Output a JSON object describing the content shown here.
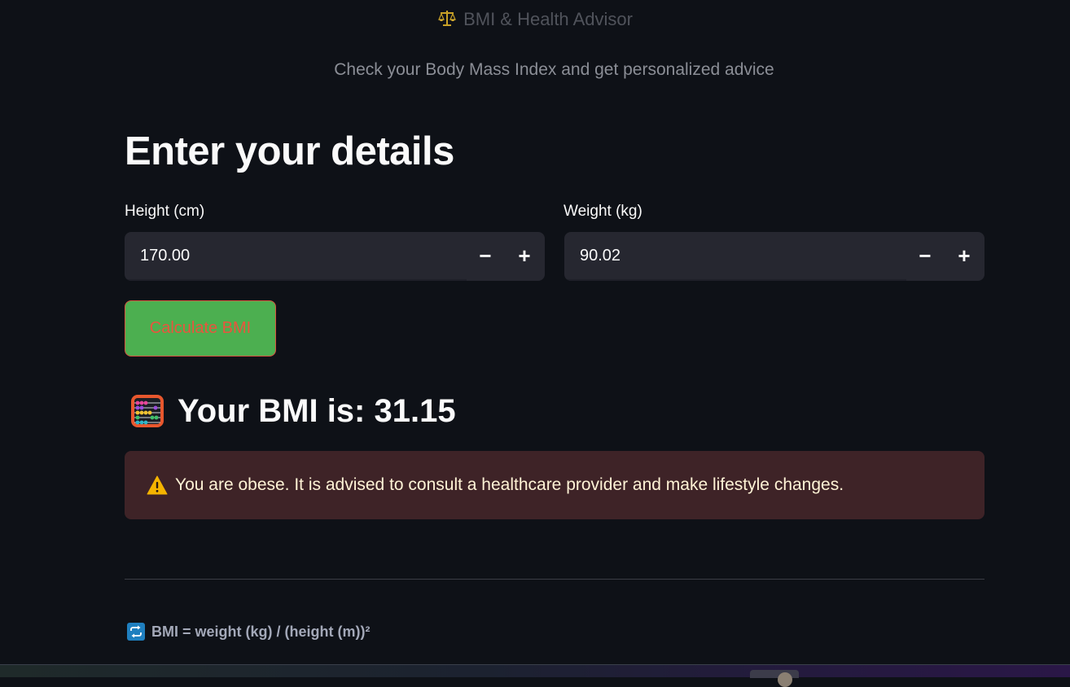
{
  "app": {
    "title": "BMI & Health Advisor",
    "title_icon": "balance-scale-icon",
    "subtitle": "Check your Body Mass Index and get personalized advice"
  },
  "form": {
    "heading": "Enter your details",
    "height": {
      "label": "Height (cm)",
      "value": "170.00",
      "decrement": "−",
      "increment": "+"
    },
    "weight": {
      "label": "Weight (kg)",
      "value": "90.02",
      "decrement": "−",
      "increment": "+"
    },
    "calculate_label": "Calculate BMI"
  },
  "result": {
    "icon": "abacus-icon",
    "text": "Your BMI is: 31.15",
    "alert_icon": "warning-icon",
    "alert_message": "You are obese. It is advised to consult a healthcare provider and make lifestyle changes."
  },
  "footer": {
    "icon": "repeat-icon",
    "formula": "BMI = weight (kg) / (height (m))²"
  },
  "colors": {
    "background": "#0e1117",
    "input_bg": "#262730",
    "button_bg": "#4caf50",
    "button_text": "#e8553e",
    "alert_bg": "#3e2327",
    "alert_text": "#fff3d6"
  }
}
